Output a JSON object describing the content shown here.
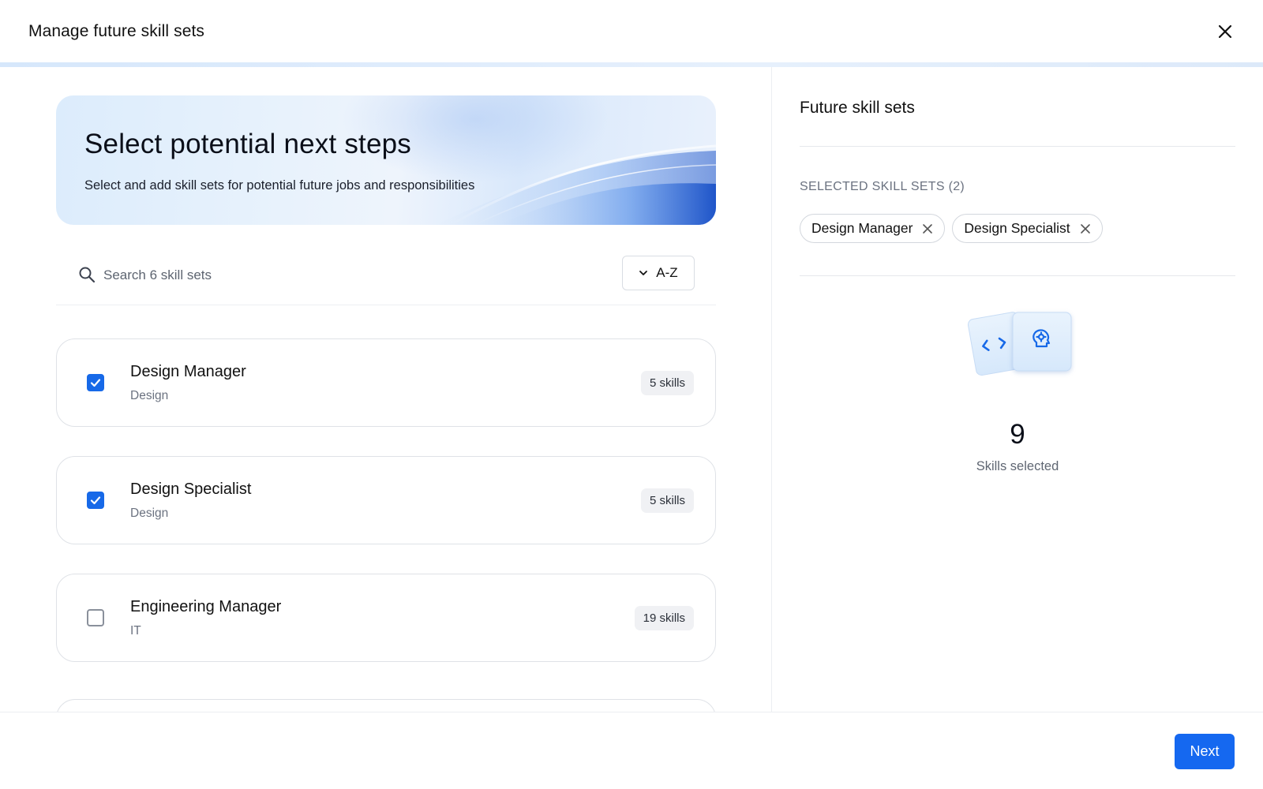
{
  "header": {
    "title": "Manage future skill sets"
  },
  "hero": {
    "title": "Select potential next steps",
    "subtitle": "Select and add skill sets for potential future jobs and responsibilities"
  },
  "search": {
    "placeholder": "Search 6 skill sets",
    "value": ""
  },
  "sort": {
    "label": "A-Z"
  },
  "skill_sets": [
    {
      "title": "Design Manager",
      "category": "Design",
      "skills": "5 skills",
      "checked": true
    },
    {
      "title": "Design Specialist",
      "category": "Design",
      "skills": "5 skills",
      "checked": true
    },
    {
      "title": "Engineering Manager",
      "category": "IT",
      "skills": "19 skills",
      "checked": false
    }
  ],
  "right": {
    "title": "Future skill sets",
    "selected_heading": "SELECTED SKILL SETS (2)",
    "chips": [
      "Design Manager",
      "Design Specialist"
    ],
    "count": "9",
    "count_label": "Skills selected"
  },
  "footer": {
    "next_label": "Next"
  },
  "colors": {
    "accent": "#1568f0",
    "checkbox": "#1769e8"
  }
}
